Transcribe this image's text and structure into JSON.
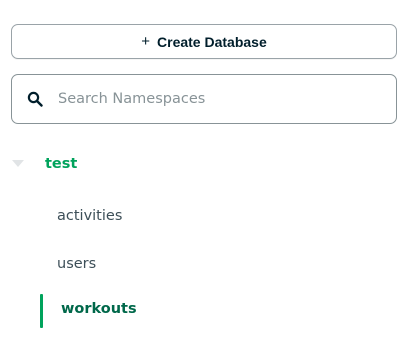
{
  "sidebar": {
    "create_button": {
      "plus": "+",
      "label": "Create Database"
    },
    "search": {
      "placeholder": "Search Namespaces",
      "value": "",
      "icon": "search-icon"
    },
    "databases": [
      {
        "name": "test",
        "expanded": true,
        "collections": [
          {
            "name": "activities",
            "active": false
          },
          {
            "name": "users",
            "active": false
          },
          {
            "name": "workouts",
            "active": true
          }
        ]
      }
    ],
    "colors": {
      "accent_green": "#00a35c",
      "active_text": "#00684a",
      "text": "#3d4f58",
      "border": "#889397"
    }
  }
}
